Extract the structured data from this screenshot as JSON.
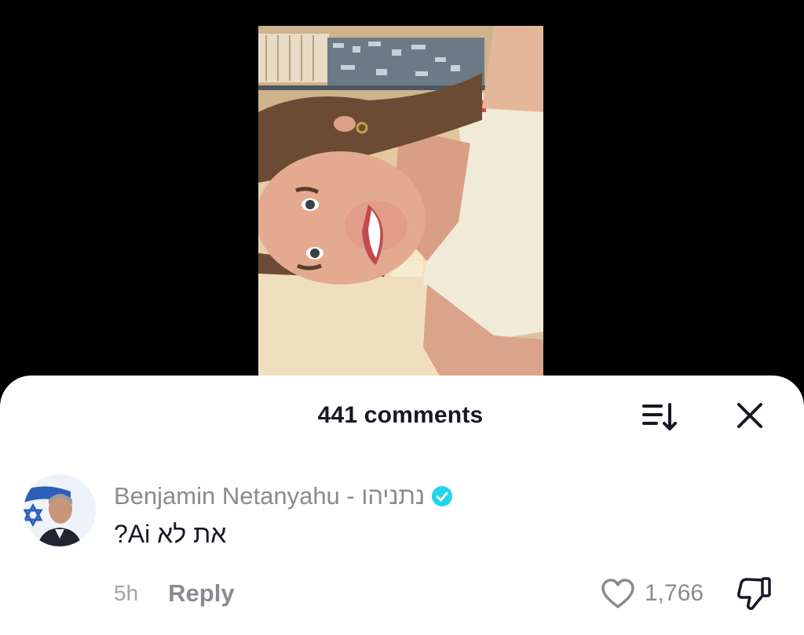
{
  "colors": {
    "sheet_background": "#ffffff",
    "video_background": "#000000",
    "primary_text": "#161823",
    "secondary_text": "#8a8b91",
    "verified_badge": "#20d5ec"
  },
  "comments_panel": {
    "title": "441 comments",
    "sort_icon": "sort-descending-icon",
    "close_icon": "close-icon"
  },
  "comment": {
    "author": "Benjamin Netanyahu - נתניהו",
    "verified_icon": "verified-badge-icon",
    "text": "את לא Ai?",
    "timestamp": "5h",
    "reply_label": "Reply",
    "like_icon": "heart-outline-icon",
    "like_count": "1,766",
    "dislike_icon": "thumbs-down-icon"
  }
}
